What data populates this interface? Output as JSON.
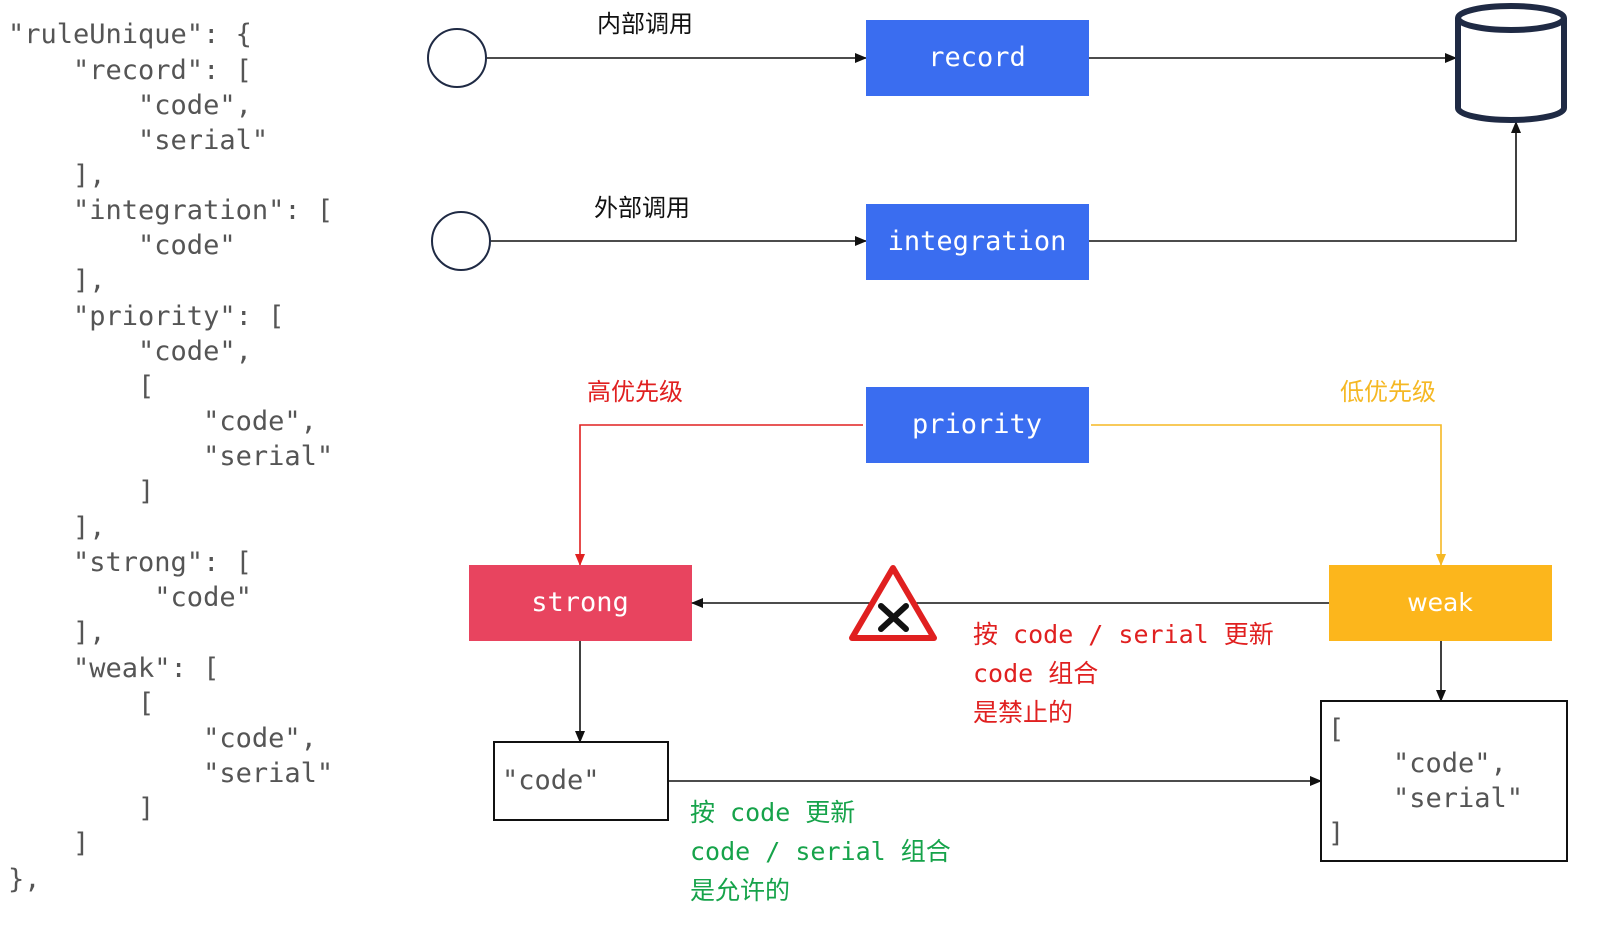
{
  "json_lines": [
    "\"ruleUnique\": {",
    "    \"record\": [",
    "        \"code\",",
    "        \"serial\"",
    "    ],",
    "    \"integration\": [",
    "        \"code\"",
    "    ],",
    "    \"priority\": [",
    "        \"code\",",
    "        [",
    "            \"code\",",
    "            \"serial\"",
    "        ]",
    "    ],",
    "    \"strong\": [",
    "         \"code\"",
    "    ],",
    "    \"weak\": [",
    "        [",
    "            \"code\",",
    "            \"serial\"",
    "        ]",
    "    ]",
    "},"
  ],
  "nodes": {
    "record": "record",
    "integration": "integration",
    "priority": "priority",
    "strong": "strong",
    "weak": "weak",
    "strong_result": "\"code\"",
    "weak_result": [
      "[",
      "    \"code\",",
      "    \"serial\"",
      "]"
    ]
  },
  "edge_labels": {
    "internal_call": "内部调用",
    "external_call": "外部调用",
    "high_priority": "高优先级",
    "low_priority": "低优先级"
  },
  "notes": {
    "forbidden": [
      "按 code / serial 更新",
      "code 组合",
      "是禁止的"
    ],
    "allowed": [
      "按 code 更新",
      "code / serial 组合",
      "是允许的"
    ]
  },
  "colors": {
    "blue": "#3a6df0",
    "red": "#e8445f",
    "yellow": "#fcb61c",
    "red_line": "#e02020",
    "yellow_line": "#f5b824",
    "green_text": "#16a34a",
    "gray_text": "#555555",
    "dark_stroke": "#1f2a44"
  }
}
